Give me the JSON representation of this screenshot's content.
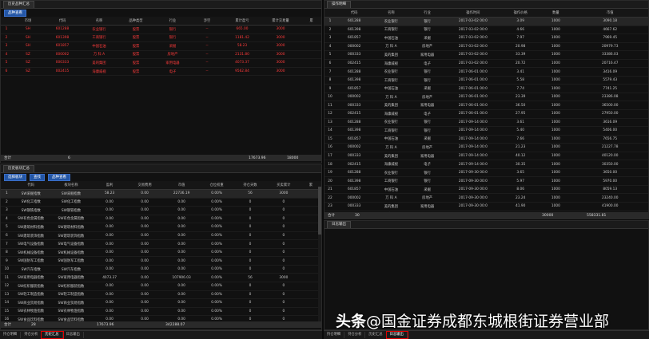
{
  "top_left": {
    "tab": "历史品种汇总",
    "button": "品种查看",
    "columns": [
      "",
      "市场",
      "代码",
      "名称",
      "品种类型",
      "行业",
      "涉空",
      "累计盈亏",
      "累计交易量",
      "累"
    ],
    "rows": [
      [
        "1",
        "SH",
        "601288",
        "农业银行",
        "股票",
        "银行",
        "--",
        "665.00",
        "3000"
      ],
      [
        "2",
        "SH",
        "601398",
        "工商银行",
        "股票",
        "银行",
        "--",
        "1181.42",
        "3000"
      ],
      [
        "3",
        "SH",
        "601857",
        "中国石油",
        "股票",
        "采掘",
        "--",
        "58.23",
        "3000"
      ],
      [
        "4",
        "SZ",
        "000002",
        "万 科 A",
        "股票",
        "房地产",
        "--",
        "2131.80",
        "3000"
      ],
      [
        "5",
        "SZ",
        "000333",
        "美的集团",
        "股票",
        "家用电器",
        "--",
        "4073.37",
        "3000"
      ],
      [
        "6",
        "SZ",
        "002415",
        "海康威视",
        "股票",
        "电子",
        "--",
        "9562.84",
        "3000"
      ]
    ],
    "total": {
      "label": "合计",
      "count": "6",
      "pnl": "17673.96",
      "volume": "18000"
    }
  },
  "bottom_left": {
    "tab": "历史板块汇总",
    "buttons": [
      "选择板块",
      "查找",
      "品种查看"
    ],
    "columns": [
      "",
      "代码",
      "板块名称",
      "盈利",
      "交易费用",
      "市值",
      "仓位权重",
      "持仓天数",
      "买卖累计",
      "累"
    ],
    "rows": [
      [
        "1",
        "SW采掘指数",
        "SW采掘指数",
        "58.23",
        "0.00",
        "22736.19",
        "0.00%",
        "56",
        "3000"
      ],
      [
        "2",
        "SW化工指数",
        "SW化工指数",
        "0.00",
        "0.00",
        "0.00",
        "0.00%",
        "0",
        "0"
      ],
      [
        "3",
        "SW钢铁指数",
        "SW钢铁指数",
        "0.00",
        "0.00",
        "0.00",
        "0.00%",
        "0",
        "0"
      ],
      [
        "4",
        "SW有色金属指数",
        "SW有色金属指数",
        "0.00",
        "0.00",
        "0.00",
        "0.00%",
        "0",
        "0"
      ],
      [
        "5",
        "SW建筑材料指数",
        "SW建筑材料指数",
        "0.00",
        "0.00",
        "0.00",
        "0.00%",
        "0",
        "0"
      ],
      [
        "6",
        "SW建筑装饰指数",
        "SW建筑装饰指数",
        "0.00",
        "0.00",
        "0.00",
        "0.00%",
        "0",
        "0"
      ],
      [
        "7",
        "SW电气设备指数",
        "SW电气设备指数",
        "0.00",
        "0.00",
        "0.00",
        "0.00%",
        "0",
        "0"
      ],
      [
        "8",
        "SW机械设备指数",
        "SW机械设备指数",
        "0.00",
        "0.00",
        "0.00",
        "0.00%",
        "0",
        "0"
      ],
      [
        "9",
        "SW国防军工指数",
        "SW国防军工指数",
        "0.00",
        "0.00",
        "0.00",
        "0.00%",
        "0",
        "0"
      ],
      [
        "10",
        "SW汽车指数",
        "SW汽车指数",
        "0.00",
        "0.00",
        "0.00",
        "0.00%",
        "0",
        "0"
      ],
      [
        "11",
        "SW家用电器指数",
        "SW家用电器指数",
        "4073.37",
        "0.00",
        "107906.03",
        "0.00%",
        "56",
        "3000"
      ],
      [
        "12",
        "SW纺织服装指数",
        "SW纺织服装指数",
        "0.00",
        "0.00",
        "0.00",
        "0.00%",
        "0",
        "0"
      ],
      [
        "13",
        "SW轻工制造指数",
        "SW轻工制造指数",
        "0.00",
        "0.00",
        "0.00",
        "0.00%",
        "0",
        "0"
      ],
      [
        "14",
        "SW商业贸易指数",
        "SW商业贸易指数",
        "0.00",
        "0.00",
        "0.00",
        "0.00%",
        "0",
        "0"
      ],
      [
        "15",
        "SW农林牧渔指数",
        "SW农林牧渔指数",
        "0.00",
        "0.00",
        "0.00",
        "0.00%",
        "0",
        "0"
      ],
      [
        "16",
        "SW食品饮料指数",
        "SW食品饮料指数",
        "0.00",
        "0.00",
        "0.00",
        "0.00%",
        "0",
        "0"
      ]
    ],
    "total": {
      "label": "合计",
      "count": "28",
      "pnl": "17673.96",
      "value": "342288.07"
    }
  },
  "right_top": {
    "tab": "操作明细",
    "columns": [
      "",
      "代码",
      "名称",
      "行业",
      "操作时间",
      "操作价格",
      "数量",
      "市值"
    ],
    "rows": [
      [
        "1",
        "601288",
        "农业银行",
        "银行",
        "2017-03-02 00:0",
        "3.09",
        "1000",
        "3090.18"
      ],
      [
        "2",
        "601398",
        "工商银行",
        "银行",
        "2017-03-02 00:0",
        "4.66",
        "1000",
        "4667.62"
      ],
      [
        "3",
        "601857",
        "中国石油",
        "采掘",
        "2017-03-02 00:0",
        "7.97",
        "1000",
        "7969.45"
      ],
      [
        "4",
        "000002",
        "万 科 A",
        "房地产",
        "2017-03-02 00:0",
        "20.98",
        "1000",
        "20979.73"
      ],
      [
        "5",
        "000333",
        "美的集团",
        "家用电器",
        "2017-03-02 00:0",
        "33.39",
        "1000",
        "33386.03"
      ],
      [
        "6",
        "002415",
        "海康威视",
        "电子",
        "2017-03-02 00:0",
        "20.72",
        "1000",
        "20716.47"
      ],
      [
        "7",
        "601288",
        "农业银行",
        "银行",
        "2017-06-01 00:0",
        "3.41",
        "1000",
        "3416.09"
      ],
      [
        "8",
        "601398",
        "工商银行",
        "银行",
        "2017-06-01 00:0",
        "5.58",
        "1000",
        "5579.43"
      ],
      [
        "9",
        "601857",
        "中国石油",
        "采掘",
        "2017-06-01 00:0",
        "7.74",
        "1000",
        "7741.25"
      ],
      [
        "10",
        "000002",
        "万 科 A",
        "房地产",
        "2017-06-01 00:0",
        "23.39",
        "1000",
        "23386.08"
      ],
      [
        "11",
        "000333",
        "美的集团",
        "家用电器",
        "2017-06-01 00:0",
        "36.50",
        "1000",
        "36500.00"
      ],
      [
        "12",
        "002415",
        "海康威视",
        "电子",
        "2017-06-01 00:0",
        "27.95",
        "1000",
        "27950.00"
      ],
      [
        "13",
        "601288",
        "农业银行",
        "银行",
        "2017-09-14 00:0",
        "3.61",
        "1000",
        "3616.09"
      ],
      [
        "14",
        "601398",
        "工商银行",
        "银行",
        "2017-09-14 00:0",
        "5.40",
        "1000",
        "5406.00"
      ],
      [
        "15",
        "601857",
        "中国石油",
        "采掘",
        "2017-09-14 00:0",
        "7.66",
        "1000",
        "7656.75"
      ],
      [
        "16",
        "000002",
        "万 科 A",
        "房地产",
        "2017-09-14 00:0",
        "21.23",
        "1000",
        "21227.78"
      ],
      [
        "17",
        "000333",
        "美的集团",
        "家用电器",
        "2017-09-14 00:0",
        "40.12",
        "1000",
        "40120.00"
      ],
      [
        "18",
        "002415",
        "海康威视",
        "电子",
        "2017-09-14 00:0",
        "30.35",
        "1000",
        "30350.00"
      ],
      [
        "19",
        "601288",
        "农业银行",
        "银行",
        "2017-09-30 00:0",
        "3.65",
        "1000",
        "3650.00"
      ],
      [
        "20",
        "601398",
        "工商银行",
        "银行",
        "2017-09-30 00:0",
        "5.97",
        "1000",
        "5970.00"
      ],
      [
        "21",
        "601857",
        "中国石油",
        "采掘",
        "2017-09-30 00:0",
        "8.06",
        "1000",
        "8059.13"
      ],
      [
        "22",
        "000002",
        "万 科 A",
        "房地产",
        "2017-09-30 00:0",
        "23.24",
        "1000",
        "23240.00"
      ],
      [
        "23",
        "000333",
        "美的集团",
        "家用电器",
        "2017-09-30 00:0",
        "41.90",
        "1000",
        "41900.00"
      ],
      [
        "24",
        "002415",
        "海康威视",
        "电子",
        "2017-09-30 00:0",
        "31.67",
        "1000",
        "31670.00"
      ],
      [
        "25",
        "601288",
        "农业银行",
        "银行",
        "2018-03-14 00:0",
        "",
        "",
        "4000.00"
      ]
    ],
    "total": {
      "label": "合计",
      "count": "30",
      "volume": "30000",
      "value": "558331.81"
    }
  },
  "right_log": {
    "tab": "日志输出"
  },
  "bottom_tabs_left": [
    "持仓明细",
    "持仓分析",
    "历史汇总",
    "日志输出"
  ],
  "bottom_tabs_right": [
    "持仓明细",
    "持仓分析",
    "历史汇总",
    "日志输出"
  ],
  "watermark": {
    "brand": "头条",
    "text": "@国金证券成都东城根街证券营业部"
  }
}
